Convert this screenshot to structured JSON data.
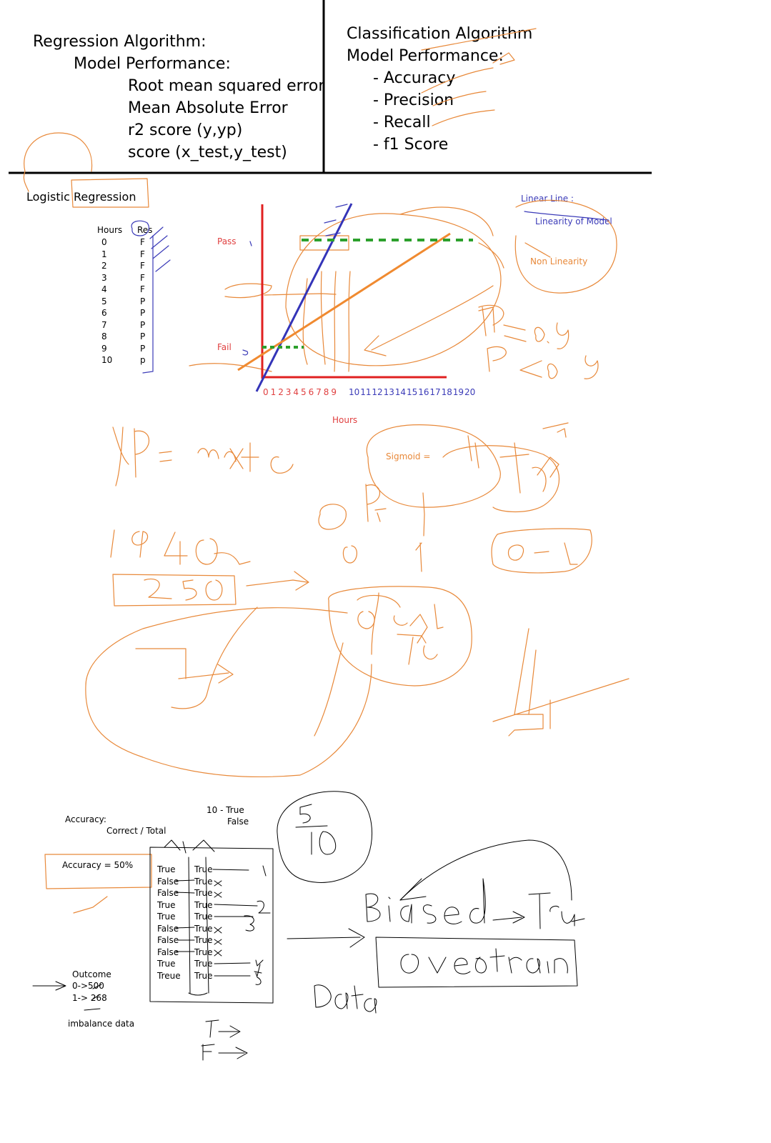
{
  "regression": {
    "title": "Regression Algorithm:",
    "subtitle": "Model Performance:",
    "metrics": [
      "Root mean squared error",
      "Mean Absolute Error",
      "r2 score (y,yp)",
      "score (x_test,y_test)"
    ]
  },
  "classification": {
    "title": "Classification Algorithm",
    "subtitle": "Model Performance:",
    "metrics": [
      "- Accuracy",
      "- Precision",
      "- Recall",
      "- f1 Score"
    ]
  },
  "logistic": {
    "title": "Logistic Regression",
    "table_headers": [
      "Hours",
      "Res"
    ],
    "hours": [
      "0",
      "1",
      "2",
      "3",
      "4",
      "5",
      "6",
      "7",
      "8",
      "9",
      "10"
    ],
    "res": [
      "F",
      "F",
      "F",
      "F",
      "F",
      "P",
      "P",
      "P",
      "P",
      "P",
      "p"
    ]
  },
  "chart": {
    "pass_label": "Pass",
    "fail_label": "Fail",
    "xlabel": "Hours",
    "ticks": [
      "0",
      "1",
      "2",
      "3",
      "4",
      "5",
      "6",
      "7",
      "8",
      "9",
      "10",
      "11",
      "12",
      "13",
      "14",
      "15",
      "16",
      "17",
      "18",
      "19",
      "20"
    ]
  },
  "notes": {
    "linear_line": "Linear Line :",
    "linearity_of_model": "Linearity of Model",
    "non_linearity": "Non Linearity",
    "sigmoid": "Sigmoid  ="
  },
  "accuracy": {
    "title": "Accuracy:",
    "formula": "Correct / Total",
    "result": "Accuracy = 50%",
    "ten_line1": "10 -  True",
    "ten_line2": "False",
    "predicted": [
      "True",
      "False",
      "False",
      "True",
      "True",
      "False",
      "False",
      "False",
      "True",
      "Treue"
    ],
    "actual": [
      "True",
      "True",
      "True",
      "True",
      "True",
      "True",
      "True",
      "True",
      "True",
      "True"
    ],
    "outcome_title": "Outcome",
    "outcome_0": "0->500",
    "outcome_1": "1-> 268",
    "imbalance": "imbalance data"
  },
  "colors": {
    "ink_orange": "#e8893a",
    "ink_blue": "#3b3bb8",
    "axis_red": "#e02020",
    "dash_green": "#2ca02c",
    "label_red": "#e04040"
  }
}
